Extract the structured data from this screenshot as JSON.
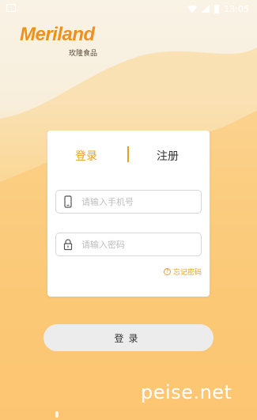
{
  "status_bar": {
    "time": "13:05"
  },
  "brand": {
    "logo_text": "Meriland",
    "logo_subtitle": "玫隆食品"
  },
  "tabs": {
    "login_label": "登录",
    "register_label": "注册"
  },
  "form": {
    "phone_placeholder": "请输入手机号",
    "phone_value": "",
    "password_placeholder": "请输入密码",
    "password_value": "",
    "forgot_label": "忘记密码",
    "forgot_icon_glyph": "?"
  },
  "submit": {
    "label": "登录"
  },
  "watermark": {
    "text": "peise.net"
  },
  "icons": {
    "phone": "phone-icon",
    "lock": "lock-icon",
    "help": "question-circle-icon"
  },
  "colors": {
    "accent": "#e8a020",
    "logo": "#f0901c",
    "button_bg": "#ececec"
  }
}
